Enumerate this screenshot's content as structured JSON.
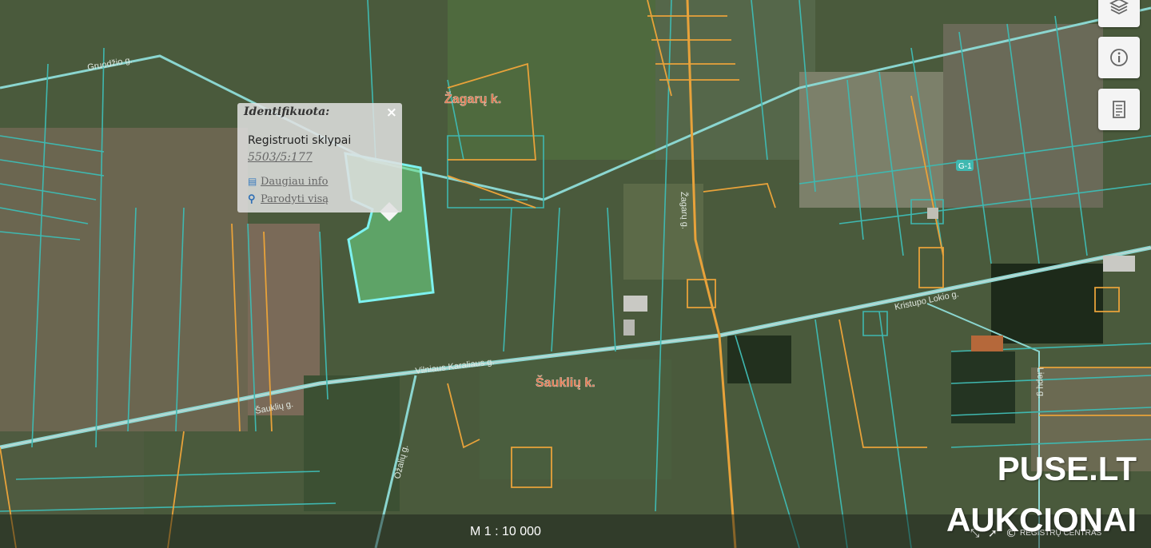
{
  "map": {
    "place_labels": [
      {
        "text": "Žagarų k.",
        "id": "zagaru"
      },
      {
        "text": "Šauklių k.",
        "id": "saukliu"
      }
    ],
    "street_labels": [
      {
        "text": "Žagarų g."
      },
      {
        "text": "Kristupo Lokio g."
      },
      {
        "text": "Vilniaus Karaliaus g."
      },
      {
        "text": "Šauklių g."
      },
      {
        "text": "Gruodžio g."
      },
      {
        "text": "Liepų g."
      },
      {
        "text": "Ožalių g."
      }
    ],
    "road_badge": "G-1",
    "colors": {
      "parcel_teal": "#3fb8b0",
      "parcel_orange": "#e8a23a",
      "selected_parcel": "#7df2f0",
      "selected_fill": "#6fe08a",
      "road_line": "#8bd6d0"
    }
  },
  "popup": {
    "heading": "Identifikuota:",
    "close_symbol": "×",
    "title": "Registruoti sklypai",
    "registry_number": "5503/5:177",
    "more_info": "Daugiau info",
    "show_all": "Parodyti visą"
  },
  "controls": [
    {
      "name": "layers-icon",
      "label": "Layers"
    },
    {
      "name": "info-icon",
      "label": "Info"
    },
    {
      "name": "legend-icon",
      "label": "Legend"
    }
  ],
  "footer": {
    "scale": "M 1 : 10 000",
    "credit": "REGISTRŲ CENTRAS"
  },
  "watermark": {
    "line1": "PUSE.LT",
    "line2": "AUKCIONAI"
  }
}
